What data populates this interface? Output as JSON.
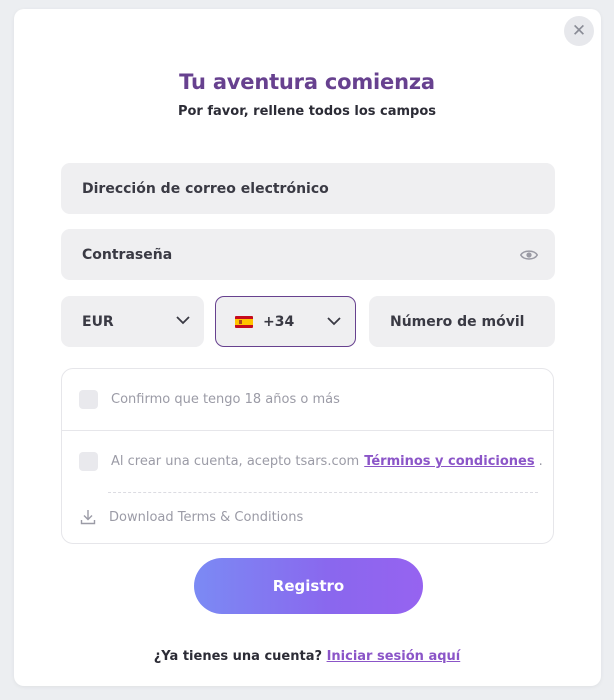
{
  "modal": {
    "close_symbol": "✕",
    "title": "Tu aventura comienza",
    "subtitle": "Por favor, rellene todos los campos"
  },
  "form": {
    "email_placeholder": "Dirección de correo electrónico",
    "password_placeholder": "Contraseña",
    "currency": "EUR",
    "phone_code": "+34",
    "phone_flag": "spain-flag-icon",
    "mobile_placeholder": "Número de móvil"
  },
  "terms": {
    "age_confirm": "Confirmo que tengo 18 años o más",
    "accept_prefix": "Al crear una cuenta, acepto tsars.com",
    "terms_link": "Términos y condiciones",
    "accept_suffix": ".",
    "download_label": "Download Terms & Conditions"
  },
  "actions": {
    "register_label": "Registro",
    "login_prompt": "¿Ya tienes una cuenta?",
    "login_link": "Iniciar sesión aquí"
  },
  "colors": {
    "title": "#67418f",
    "accent_link": "#8b55c8",
    "button_gradient_start": "#7b8af4",
    "button_gradient_end": "#9663f0",
    "field_bg": "#efeff1"
  }
}
